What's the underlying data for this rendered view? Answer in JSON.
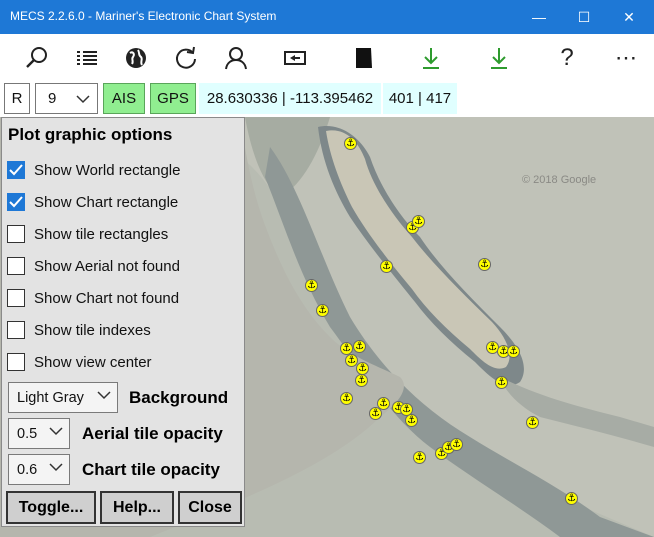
{
  "window": {
    "title": "MECS 2.2.6.0 - Mariner's Electronic Chart System",
    "minimize": "—",
    "maximize": "☐",
    "close": "✕"
  },
  "toolbar": {
    "icons": [
      "search-icon",
      "list-icon",
      "globe-icon",
      "refresh-icon",
      "user-icon",
      "back-button-icon",
      "chart-square-icon",
      "download-icon",
      "download-icon",
      "help-icon",
      "more-icon"
    ],
    "help_label": "?",
    "more_label": "⋯",
    "download_color": "#2e9b2e"
  },
  "statusbar": {
    "r_label": "R",
    "zoom_level": "9",
    "ais_label": "AIS",
    "gps_label": "GPS",
    "coordinates": "28.630336 | -113.395462",
    "tile_xy": "401 | 417",
    "toggle_on_color": "#90ee90",
    "info_bg": "#e0ffff"
  },
  "map": {
    "watermark": "© 2018 Google",
    "anchor_color": "#ffff00"
  },
  "panel": {
    "title": "Plot graphic options",
    "options": [
      {
        "label": "Show World rectangle",
        "checked": true
      },
      {
        "label": "Show Chart rectangle",
        "checked": true
      },
      {
        "label": "Show tile rectangles",
        "checked": false
      },
      {
        "label": "Show Aerial not found",
        "checked": false
      },
      {
        "label": "Show Chart not found",
        "checked": false
      },
      {
        "label": "Show tile indexes",
        "checked": false
      },
      {
        "label": "Show view center",
        "checked": false
      }
    ],
    "background_value": "Light Gray",
    "background_label": "Background",
    "aerial_opacity_value": "0.5",
    "aerial_opacity_label": "Aerial tile opacity",
    "chart_opacity_value": "0.6",
    "chart_opacity_label": "Chart tile opacity",
    "toggle_label": "Toggle...",
    "help_label": "Help...",
    "close_label": "Close"
  }
}
